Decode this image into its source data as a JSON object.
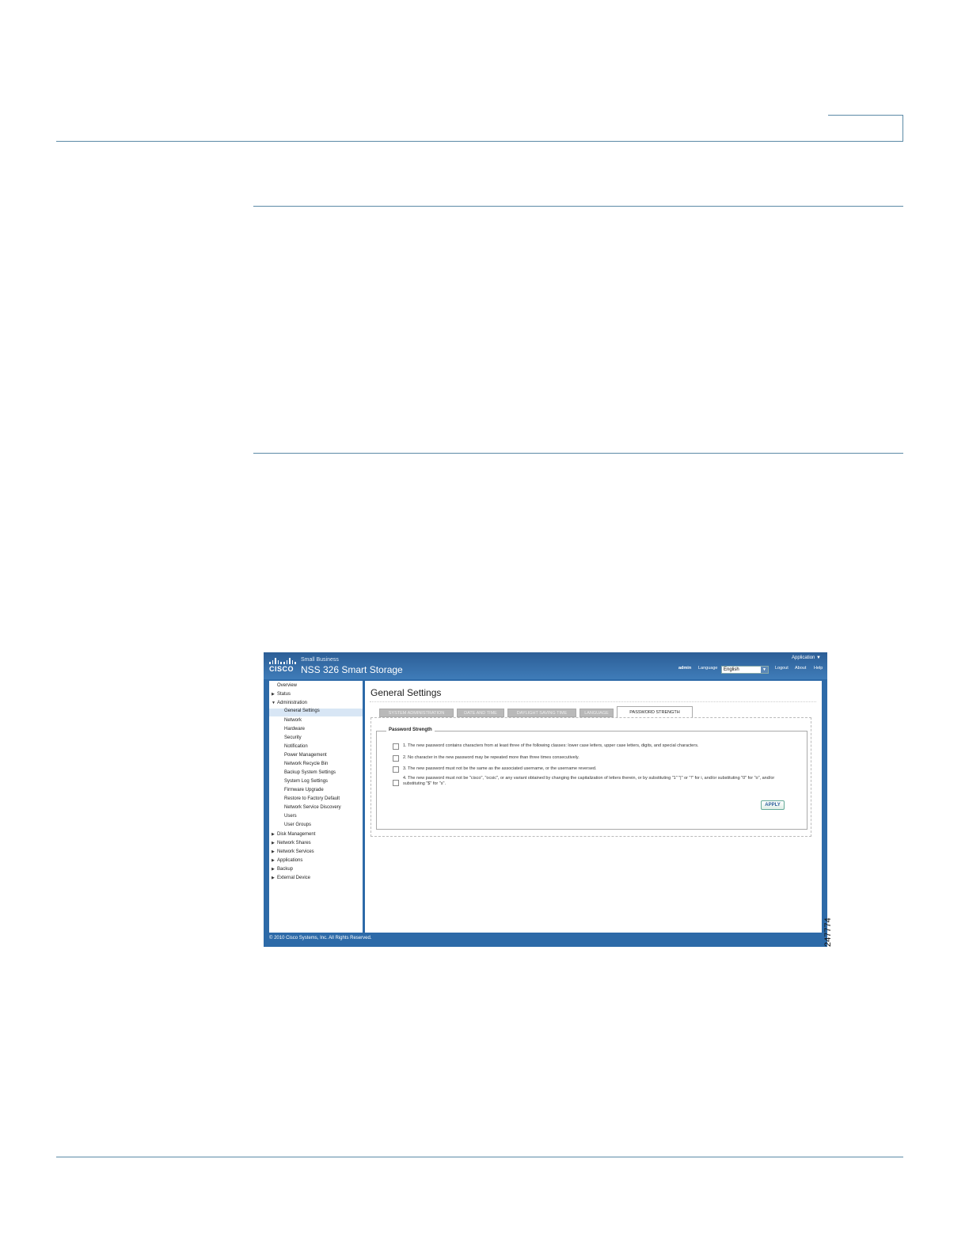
{
  "screenshot": {
    "brand": "CISCO",
    "subtitle": "Small Business",
    "product": "NSS 326 Smart Storage",
    "application_menu": "Application ▼",
    "user": "admin",
    "language_label": "Language",
    "language_value": "English",
    "logout": "Logout",
    "about": "About",
    "help": "Help",
    "nav": [
      {
        "label": "Overview"
      },
      {
        "label": "Status"
      },
      {
        "label": "Administration"
      },
      {
        "label": "General Settings"
      },
      {
        "label": "Network"
      },
      {
        "label": "Hardware"
      },
      {
        "label": "Security"
      },
      {
        "label": "Notification"
      },
      {
        "label": "Power Management"
      },
      {
        "label": "Network Recycle Bin"
      },
      {
        "label": "Backup System Settings"
      },
      {
        "label": "System Log Settings"
      },
      {
        "label": "Firmware Upgrade"
      },
      {
        "label": "Restore to Factory Default"
      },
      {
        "label": "Network Service Discovery"
      },
      {
        "label": "Users"
      },
      {
        "label": "User Groups"
      },
      {
        "label": "Disk Management"
      },
      {
        "label": "Network Shares"
      },
      {
        "label": "Network Services"
      },
      {
        "label": "Applications"
      },
      {
        "label": "Backup"
      },
      {
        "label": "External Device"
      }
    ],
    "page_title": "General Settings",
    "tabs": [
      {
        "label": "SYSTEM ADMINISTRATION"
      },
      {
        "label": "DATE AND TIME"
      },
      {
        "label": "DAYLIGHT SAVING TIME"
      },
      {
        "label": "LANGUAGE"
      },
      {
        "label": "PASSWORD STRENGTH"
      }
    ],
    "fieldset_legend": "Password Strength",
    "rules": [
      {
        "text": "1. The new password contains characters from at least three of the following classes: lower case letters, upper case letters, digits, and special characters."
      },
      {
        "text": "2. No character in the new password may be repeated more than three times consecutively."
      },
      {
        "text": "3. The new password must not be the same as the associated username, or the username reversed."
      },
      {
        "text": "4. The new password must not be \"cisco\", \"ocsic\", or any variant obtained by changing the capitalization of letters therein, or by substituting \"1\" \"|\" or \"!\" for i, and/or substituting \"0\" for \"o\", and/or substituting \"$\" for \"s\"."
      }
    ],
    "apply_label": "APPLY",
    "copyright": "© 2010 Cisco Systems, Inc. All Rights Reserved."
  },
  "figure_number": "247774"
}
